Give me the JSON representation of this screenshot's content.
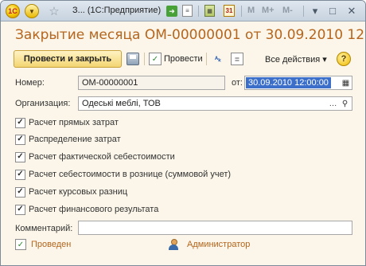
{
  "titlebar": {
    "logo_text": "1С",
    "window_title": "З...  (1С:Предприятие)",
    "calendar_text": "31",
    "memory_buttons": [
      "M",
      "M+",
      "M-"
    ],
    "win_controls": [
      "▾",
      "□",
      "✕"
    ]
  },
  "document": {
    "heading": "Закрытие месяца ОМ-00000001 от 30.09.2010 12:..."
  },
  "commandbar": {
    "post_and_close_label": "Провести и закрыть",
    "post_label": "Провести",
    "all_actions_label": "Все действия ▾",
    "help_label": "?"
  },
  "fields": {
    "number_label": "Номер:",
    "number_value": "ОМ-00000001",
    "date_label": "от:",
    "date_value": "30.09.2010 12:00:00",
    "organization_label": "Организация:",
    "organization_value": "Одеські меблі, ТОВ",
    "comment_label": "Комментарий:",
    "comment_value": ""
  },
  "checkboxes": [
    {
      "label": "Расчет прямых затрат",
      "checked": true
    },
    {
      "label": "Распределение затрат",
      "checked": true
    },
    {
      "label": "Расчет фактической себестоимости",
      "checked": true
    },
    {
      "label": "Расчет себестоимости в рознице (суммовой учет)",
      "checked": true
    },
    {
      "label": "Расчет курсовых разниц",
      "checked": true
    },
    {
      "label": "Расчет финансового результата",
      "checked": true
    }
  ],
  "footer": {
    "status_label": "Проведен",
    "user_label": "Администратор"
  },
  "colors": {
    "accent": "#b5651d",
    "window_bg": "#fbf6e9",
    "selection": "#3b6fc9"
  }
}
